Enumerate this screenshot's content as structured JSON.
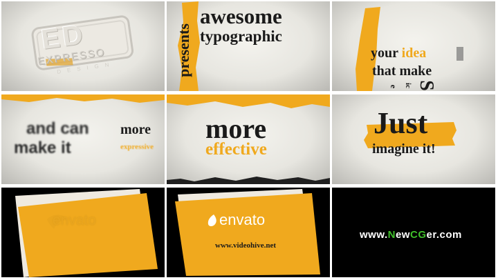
{
  "frames": {
    "logo": {
      "mark": "ED",
      "line1": "EXPRESSO",
      "line2": "DESIGN"
    },
    "presents": {
      "vertical": "presents",
      "line1": "awesome",
      "line2": "typographic"
    },
    "idea": {
      "line1_a": "your ",
      "line1_b": "idea",
      "line2": "that make",
      "fragment1": "e",
      "fragment2": "ic",
      "fragment3": "S"
    },
    "can": {
      "word1": "and can",
      "word2": "make it",
      "word3": "more",
      "word4": "expressive"
    },
    "more": {
      "line1": "more",
      "line2": "effective"
    },
    "just": {
      "line1": "Just",
      "line2": "imagine it!"
    },
    "envato_faded": {
      "brand": "envato"
    },
    "envato_card": {
      "brand": "envato",
      "url": "www.videohive.net"
    },
    "watermark": {
      "prefix": "www.",
      "n": "N",
      "ew": "ew",
      "cg": "CG",
      "suffix": "er.com"
    }
  },
  "colors": {
    "accent": "#f0a91e",
    "text_dark": "#1a1a1a",
    "green": "#3fbf2a",
    "white": "#ffffff"
  }
}
